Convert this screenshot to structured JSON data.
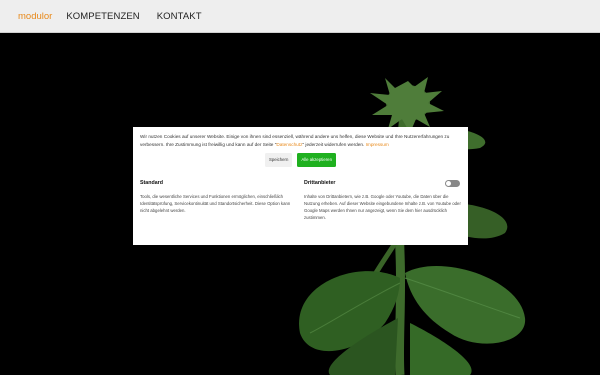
{
  "nav": {
    "logo": "modulor",
    "links": [
      "KOMPETENZEN",
      "KONTAKT"
    ]
  },
  "cookie": {
    "intro_text": "Wir nutzen Cookies auf unserer Website. Einige von ihnen sind essenziell, während andere uns helfen, diese Website und Ihre Nutzererfahrungen zu verbessern. Ihre Zustimmung ist freiwillig und kann auf der Seite \"",
    "privacy_link": "Datenschutz",
    "intro_text_2": "\" jederzeit widerrufen werden.",
    "imprint_link": "Impressum",
    "save_label": "Speichern",
    "accept_label": "Alle akzeptieren",
    "standard": {
      "title": "Standard",
      "text": "Tools, die wesentliche Services und Funktionen ermöglichen, einschließlich Identitätsprüfung, Servicekontinuität und Standortsicherheit. Diese Option kann nicht abgelehnt werden."
    },
    "third_party": {
      "title": "Drittanbieter",
      "text": "Inhalte von Drittanbietern, wie z.B. Google oder Youtube, die Daten über die Nutzung erheben. Auf dieser Website eingebundene Inhalte z.B. von Youtube oder Google Maps werden Ihnen nur angezeigt, wenn Sie dem hier ausdrücklich zustimmen.",
      "toggle_on": false
    }
  },
  "colors": {
    "accent": "#e8891a",
    "accept_button": "#1fb01f",
    "nav_bg": "#eeeeee"
  }
}
